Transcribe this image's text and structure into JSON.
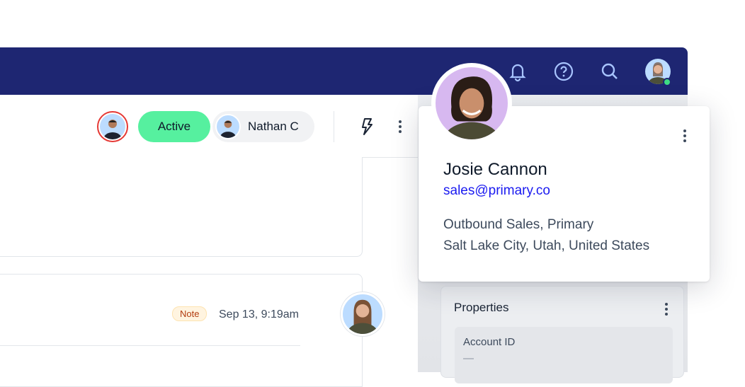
{
  "toolbar": {
    "status_label": "Active",
    "assignee_name": "Nathan C"
  },
  "nav": {
    "icons": [
      "bell-icon",
      "help-icon",
      "search-icon"
    ],
    "online_status_color": "#3ddc84"
  },
  "timeline": {
    "badge": "Note",
    "timestamp": "Sep 13, 9:19am"
  },
  "profile": {
    "name": "Josie Cannon",
    "email": "sales@primary.co",
    "team": "Outbound Sales, Primary",
    "location": "Salt Lake City, Utah, United States"
  },
  "properties": {
    "title": "Properties",
    "fields": [
      {
        "label": "Account ID",
        "value": "—"
      }
    ]
  },
  "colors": {
    "nav": "#1e2672",
    "active": "#56f09f",
    "link": "#1a1af0"
  }
}
